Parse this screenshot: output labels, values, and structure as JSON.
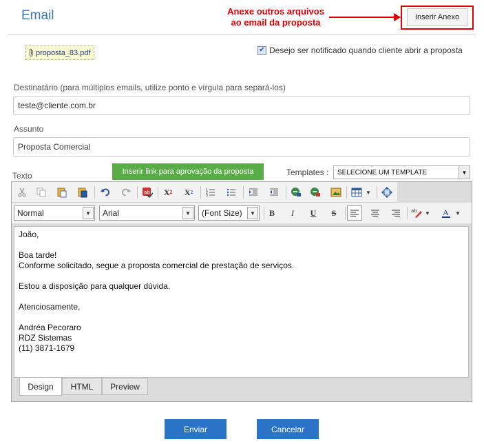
{
  "header": {
    "title": "Email",
    "annotation_line1": "Anexe outros arquivos",
    "annotation_line2": "ao email da proposta",
    "attach_button": "Inserir Anexo"
  },
  "attachment": {
    "file_name": "proposta_83.pdf"
  },
  "notify": {
    "checked": true,
    "label": "Desejo ser notificado quando cliente abrir a proposta"
  },
  "recipient": {
    "label": "Destinatário (para múltiplos emails, utilize ponto e vírgula para separá-los)",
    "value": "teste@cliente.com.br"
  },
  "subject": {
    "label": "Assunto",
    "value": "Proposta Comercial"
  },
  "text": {
    "label": "Texto",
    "approval_link_button": "Inserir link para aprovação da proposta",
    "templates_label": "Templates :",
    "templates_selected": "SELECIONE UM TEMPLATE"
  },
  "toolbar": {
    "format": "Normal",
    "font": "Arial",
    "font_size": "(Font Size)",
    "bold": "B",
    "italic": "I",
    "underline": "U",
    "strike": "S"
  },
  "editor_body": [
    "João,",
    "",
    "Boa tarde!",
    "Conforme solicitado, segue a proposta comercial de prestação de serviços.",
    "",
    "Estou a disposição para qualquer dúvida.",
    "",
    "Atenciosamente,",
    "",
    "Andréa Pecoraro",
    "RDZ Sistemas",
    "(11) 3871-1679"
  ],
  "editor_tabs": [
    "Design",
    "HTML",
    "Preview"
  ],
  "actions": {
    "send": "Enviar",
    "cancel": "Cancelar"
  },
  "colors": {
    "title": "#3a79c0",
    "annotation": "#e00000",
    "green_button": "#5aac48",
    "blue_button": "#2b73c7"
  },
  "icons": [
    "paperclip-icon",
    "cut-icon",
    "copy-icon",
    "paste-icon",
    "paste-word-icon",
    "undo-icon",
    "redo-icon",
    "spellcheck-icon",
    "superscript-icon",
    "subscript-icon",
    "ordered-list-icon",
    "unordered-list-icon",
    "indent-icon",
    "outdent-icon",
    "link-icon",
    "unlink-icon",
    "image-icon",
    "table-icon",
    "fullscreen-icon",
    "align-left-icon",
    "align-center-icon",
    "align-right-icon",
    "highlight-icon",
    "font-color-icon"
  ]
}
